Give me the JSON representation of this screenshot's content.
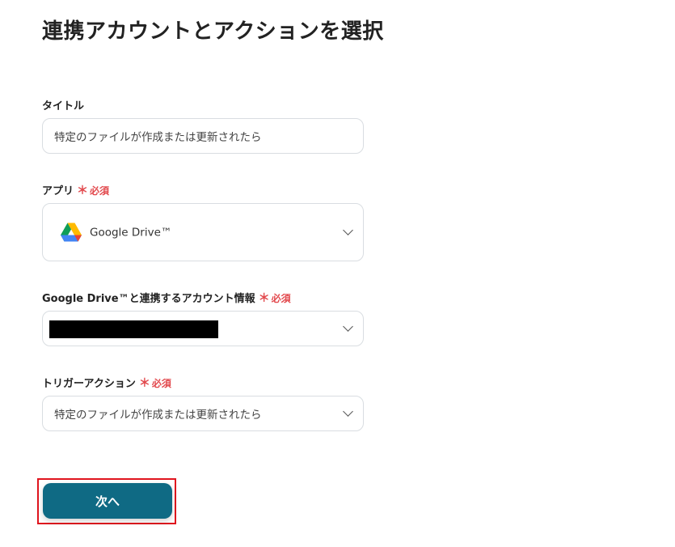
{
  "page": {
    "title": "連携アカウントとアクションを選択"
  },
  "required_label": "必須",
  "required_mark": "＊",
  "fields": {
    "title": {
      "label": "タイトル",
      "value": "特定のファイルが作成または更新されたら"
    },
    "app": {
      "label": "アプリ",
      "value": "Google Drive™",
      "icon": "google-drive-icon"
    },
    "account": {
      "label": "Google Drive™と連携するアカウント情報",
      "value": ""
    },
    "trigger": {
      "label": "トリガーアクション",
      "value": "特定のファイルが作成または更新されたら"
    }
  },
  "actions": {
    "next_label": "次へ"
  },
  "colors": {
    "accent": "#0f6a84",
    "required": "#e2494d",
    "highlight": "#e0141e"
  }
}
